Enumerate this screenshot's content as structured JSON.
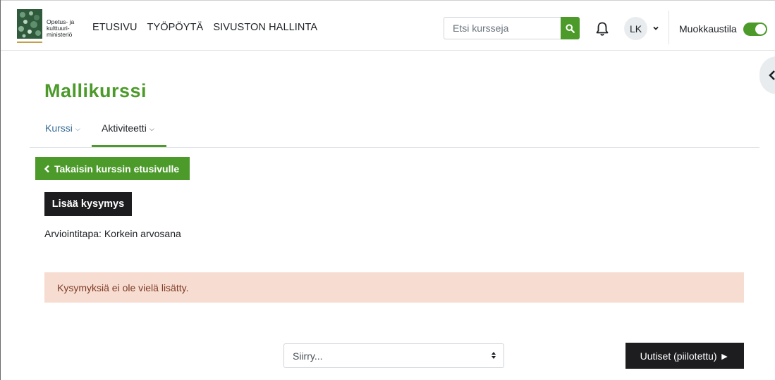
{
  "brand": {
    "logo_icon": "ministry-emblem-icon",
    "line1": "Opetus- ja",
    "line2": "kulttuuri-",
    "line3": "ministeriö"
  },
  "nav": {
    "items": [
      {
        "label": "ETUSIVU"
      },
      {
        "label": "TYÖPÖYTÄ"
      },
      {
        "label": "SIVUSTON HALLINTA"
      }
    ]
  },
  "search": {
    "placeholder": "Etsi kursseja",
    "icon": "search-icon"
  },
  "user": {
    "initials": "LK"
  },
  "edit_mode": {
    "label": "Muokkaustila",
    "on": true
  },
  "course": {
    "title": "Mallikurssi"
  },
  "secondary_nav": {
    "tabs": [
      {
        "label": "Kurssi",
        "active": false
      },
      {
        "label": "Aktiviteetti",
        "active": true
      }
    ]
  },
  "actions": {
    "back_label": "Takaisin kurssin etusivulle",
    "add_question_label": "Lisää kysymys"
  },
  "grading": {
    "text": "Arviointitapa: Korkein arvosana"
  },
  "alert": {
    "text": "Kysymyksiä ei ole vielä lisätty."
  },
  "footer_nav": {
    "jump_label": "Siirry...",
    "next_label": "Uutiset (piilotettu) ►"
  },
  "colors": {
    "accent": "#4c9a2a",
    "alert_bg": "#f7dcd1",
    "alert_text": "#7d3b25",
    "dark_button": "#1d1d1f"
  }
}
